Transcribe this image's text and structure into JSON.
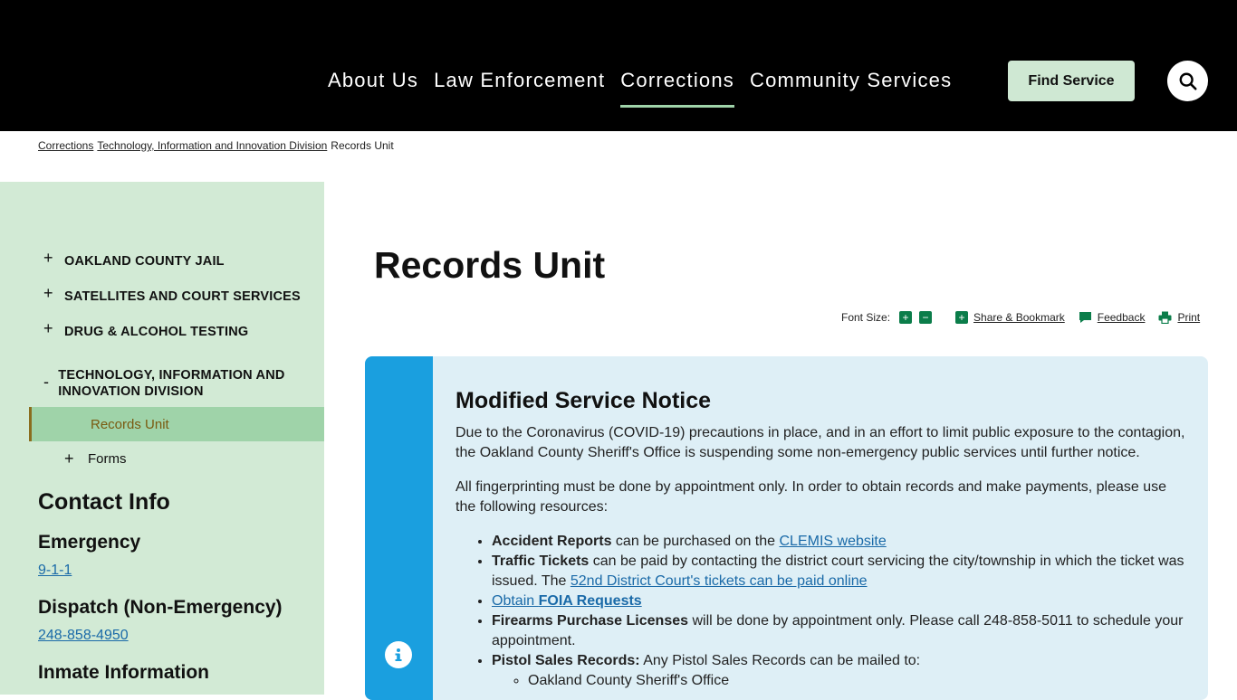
{
  "header": {
    "nav": [
      {
        "label": "About Us",
        "active": false
      },
      {
        "label": "Law Enforcement",
        "active": false
      },
      {
        "label": "Corrections",
        "active": true
      },
      {
        "label": "Community Services",
        "active": false
      }
    ],
    "find_service": "Find Service",
    "accent_color": "#9fd3a9"
  },
  "breadcrumb": {
    "items": [
      "Corrections",
      "Technology, Information and Innovation Division"
    ],
    "current": "Records Unit"
  },
  "sidebar": {
    "items": [
      {
        "sign": "+",
        "label": "Oakland County Jail"
      },
      {
        "sign": "+",
        "label": "Satellites and Court Services"
      },
      {
        "sign": "+",
        "label": "Drug & Alcohol Testing"
      },
      {
        "sign": "-",
        "label": "Technology, Information and Innovation Division"
      }
    ],
    "active_sub": "Records Unit",
    "forms": {
      "sign": "+",
      "label": "Forms"
    }
  },
  "contact": {
    "title": "Contact Info",
    "emergency_label": "Emergency",
    "emergency_phone": "9-1-1",
    "dispatch_label": "Dispatch (Non-Emergency)",
    "dispatch_phone": "248-858-4950",
    "inmate_label": "Inmate Information"
  },
  "main": {
    "title": "Records Unit",
    "tools": {
      "font_size": "Font Size:",
      "plus": "+",
      "minus": "−",
      "share": "Share & Bookmark",
      "feedback": "Feedback",
      "print": "Print"
    }
  },
  "notice": {
    "title": "Modified Service Notice",
    "p1": "Due to the Coronavirus (COVID-19) precautions in place, and in an effort to limit public exposure to the contagion, the Oakland County Sheriff's Office is suspending some non-emergency public services until further notice.",
    "p2": "All fingerprinting must be done by appointment only. In order to obtain records and make payments, please use the following resources:",
    "b1_bold": "Accident Reports",
    "b1_text": " can be purchased on the ",
    "b1_link": "CLEMIS website",
    "b2_bold": "Traffic Tickets",
    "b2_text": " can be paid by contacting the district court servicing the city/township in which the ticket was issued. The ",
    "b2_link": "52nd District Court's tickets can be paid online",
    "b3_link_pre": "Obtain ",
    "b3_link_bold": "FOIA Requests",
    "b4_bold": "Firearms Purchase Licenses",
    "b4_text": " will be done by appointment only. Please call 248-858-5011 to schedule your appointment.",
    "b5_bold": "Pistol Sales Records:",
    "b5_text": " Any Pistol Sales Records can be mailed to:",
    "b5_sub": "Oakland County Sheriff's Office",
    "bar_color": "#1a9fdf"
  }
}
